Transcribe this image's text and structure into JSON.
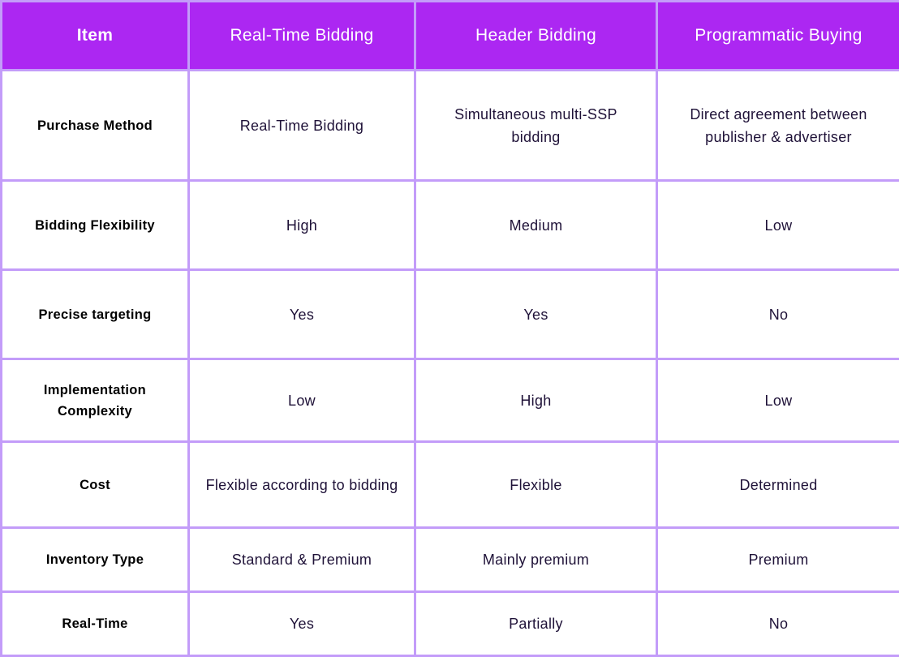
{
  "colors": {
    "header_bg": "#ac27f2",
    "border": "#c39cf9",
    "header_text": "#ffffff",
    "body_text": "#1f1238"
  },
  "table": {
    "headers": [
      "Item",
      "Real-Time Bidding",
      "Header Bidding",
      "Programmatic Buying"
    ],
    "rows": [
      {
        "label": "Purchase Method",
        "cells": [
          "Real-Time Bidding",
          "Simultaneous multi-SSP bidding",
          "Direct agreement between publisher & advertiser"
        ]
      },
      {
        "label": "Bidding Flexibility",
        "cells": [
          "High",
          "Medium",
          "Low"
        ]
      },
      {
        "label": "Precise targeting",
        "cells": [
          "Yes",
          "Yes",
          "No"
        ]
      },
      {
        "label": "Implementation Complexity",
        "cells": [
          "Low",
          "High",
          "Low"
        ]
      },
      {
        "label": "Cost",
        "cells": [
          "Flexible according to bidding",
          "Flexible",
          "Determined"
        ]
      },
      {
        "label": "Inventory Type",
        "cells": [
          "Standard & Premium",
          "Mainly premium",
          "Premium"
        ]
      },
      {
        "label": "Real-Time",
        "cells": [
          "Yes",
          "Partially",
          "No"
        ]
      }
    ]
  }
}
